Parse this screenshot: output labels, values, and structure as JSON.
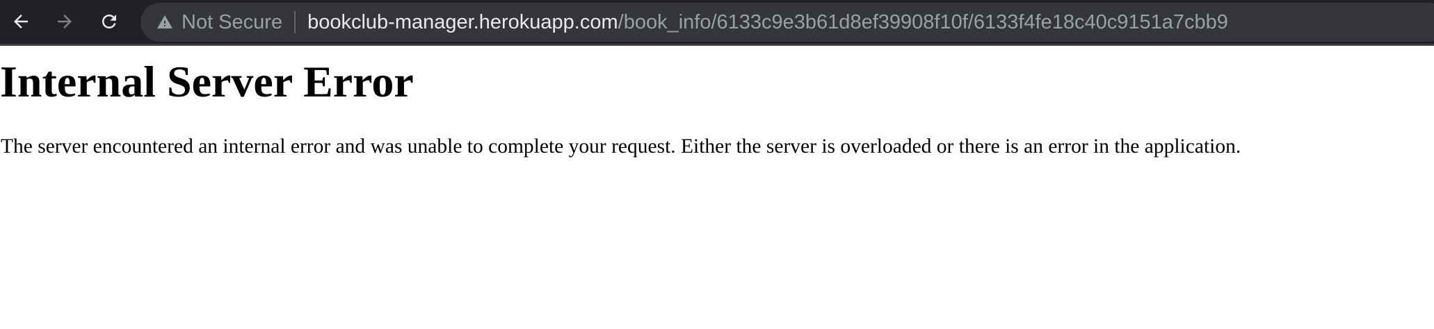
{
  "browser": {
    "security_label": "Not Secure",
    "url_host": "bookclub-manager.herokuapp.com",
    "url_path": "/book_info/6133c9e3b61d8ef39908f10f/6133f4fe18c40c9151a7cbb9",
    "icons": {
      "back": "back-arrow-icon",
      "forward": "forward-arrow-icon",
      "reload": "reload-icon",
      "security": "warning-triangle-icon"
    },
    "colors": {
      "toolbar_bg": "#202124",
      "omnibox_bg": "#35363a",
      "host_text": "#e8eaed",
      "muted_text": "#9aa0a6"
    }
  },
  "page": {
    "title": "Internal Server Error",
    "message": "The server encountered an internal error and was unable to complete your request. Either the server is overloaded or there is an error in the application."
  }
}
